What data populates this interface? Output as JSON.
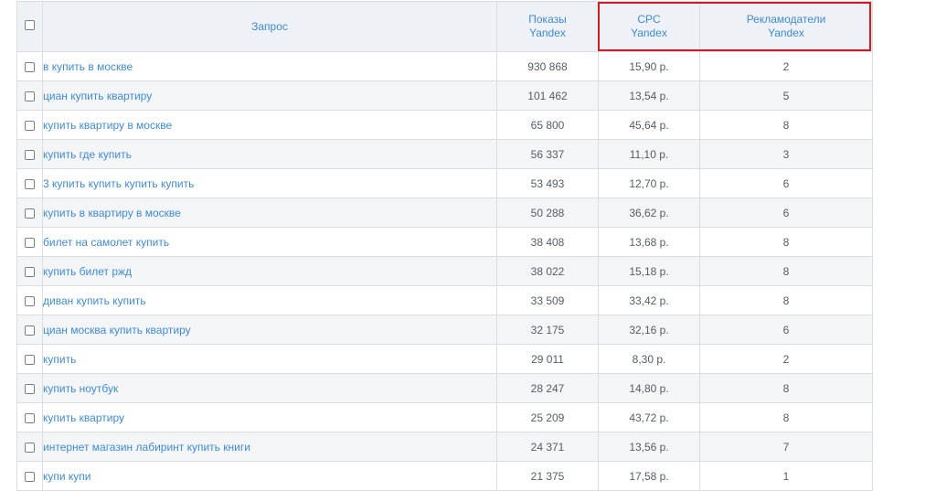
{
  "table": {
    "headers": {
      "query": "Запрос",
      "impressions": [
        "Показы",
        "Yandex"
      ],
      "cpc": [
        "CPC",
        "Yandex"
      ],
      "advertisers": [
        "Рекламодатели",
        "Yandex"
      ]
    },
    "rows": [
      {
        "query": "в купить в москве",
        "impressions": "930 868",
        "cpc": "15,90 р.",
        "advertisers": "2"
      },
      {
        "query": "циан купить квартиру",
        "impressions": "101 462",
        "cpc": "13,54 р.",
        "advertisers": "5"
      },
      {
        "query": "купить квартиру в москве",
        "impressions": "65 800",
        "cpc": "45,64 р.",
        "advertisers": "8"
      },
      {
        "query": "купить где купить",
        "impressions": "56 337",
        "cpc": "11,10 р.",
        "advertisers": "3"
      },
      {
        "query": "3 купить купить купить купить",
        "impressions": "53 493",
        "cpc": "12,70 р.",
        "advertisers": "6"
      },
      {
        "query": "купить в квартиру в москве",
        "impressions": "50 288",
        "cpc": "36,62 р.",
        "advertisers": "6"
      },
      {
        "query": "билет на самолет купить",
        "impressions": "38 408",
        "cpc": "13,68 р.",
        "advertisers": "8"
      },
      {
        "query": "купить билет ржд",
        "impressions": "38 022",
        "cpc": "15,18 р.",
        "advertisers": "8"
      },
      {
        "query": "диван купить купить",
        "impressions": "33 509",
        "cpc": "33,42 р.",
        "advertisers": "8"
      },
      {
        "query": "циан москва купить квартиру",
        "impressions": "32 175",
        "cpc": "32,16 р.",
        "advertisers": "6"
      },
      {
        "query": "купить",
        "impressions": "29 011",
        "cpc": "8,30 р.",
        "advertisers": "2"
      },
      {
        "query": "купить ноутбук",
        "impressions": "28 247",
        "cpc": "14,80 р.",
        "advertisers": "8"
      },
      {
        "query": "купить квартиру",
        "impressions": "25 209",
        "cpc": "43,72 р.",
        "advertisers": "8"
      },
      {
        "query": "интернет магазин лабиринт купить книги",
        "impressions": "24 371",
        "cpc": "13,56 р.",
        "advertisers": "7"
      },
      {
        "query": "купи купи",
        "impressions": "21 375",
        "cpc": "17,58 р.",
        "advertisers": "1"
      }
    ]
  },
  "colors": {
    "link": "#3d8bd4",
    "header_bg": "#eef1f6",
    "highlight": "#d21a22"
  }
}
